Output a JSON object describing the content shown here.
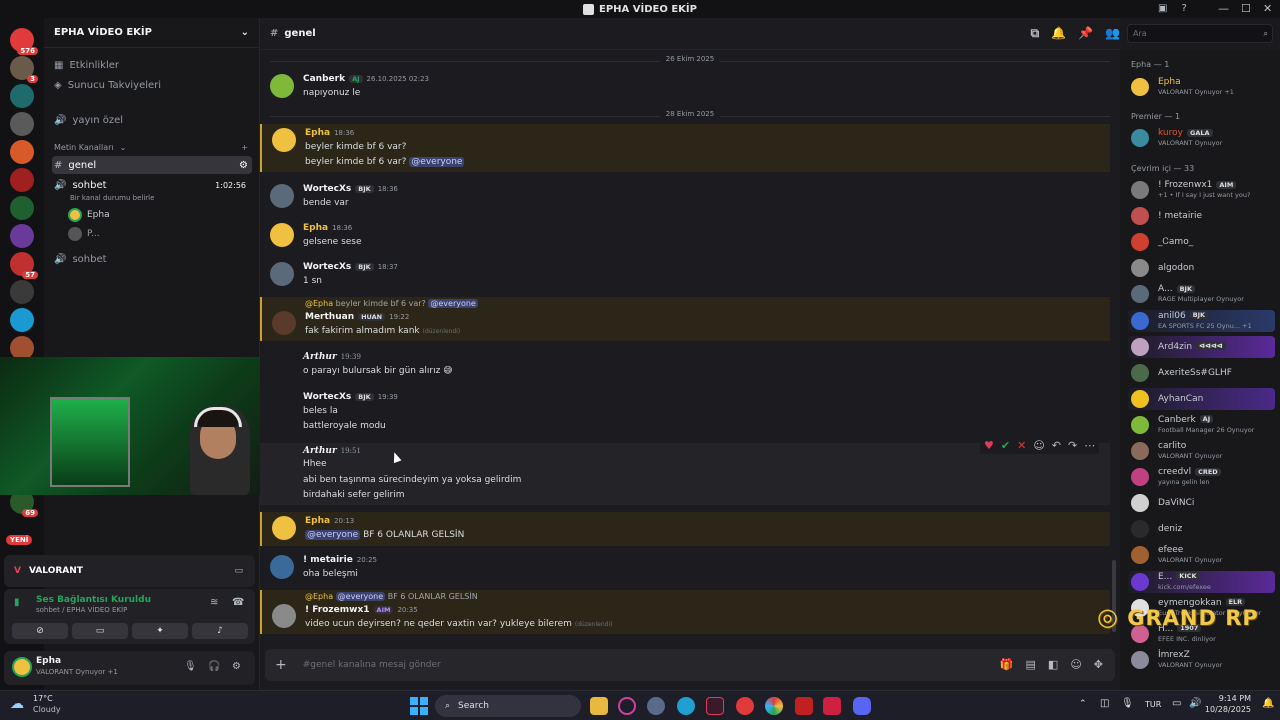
{
  "window": {
    "title": "EPHA VİDEO EKİP"
  },
  "guilds": {
    "badges": [
      "576",
      "3",
      "57",
      "69"
    ],
    "new_label": "YENİ"
  },
  "server": {
    "name": "EPHA VİDEO EKİP",
    "top_items": [
      "Etkinlikler",
      "Sunucu Takviyeleri"
    ],
    "channels": {
      "yayin": "yayın özel",
      "category": "Metin Kanalları",
      "genel": "genel",
      "sohbet_voice": "sohbet",
      "sohbet_time": "1:02:56",
      "sohbet_status": "Bir kanal durumu belirle",
      "voice_users": [
        "Epha",
        "P..."
      ],
      "sohbet2": "sohbet"
    }
  },
  "voice_panel": {
    "game": "VALORANT",
    "connection": "Ses Bağlantısı Kuruldu",
    "location": "sohbet / EPHA VİDEO EKİP"
  },
  "user": {
    "name": "Epha",
    "activity": "VALORANT Oynuyor +1"
  },
  "channel": {
    "name": "genel",
    "composer_placeholder": "#genel kanalına mesaj gönder",
    "dates": [
      "26 Ekim 2025",
      "28 Ekim 2025"
    ]
  },
  "messages": [
    {
      "author": "Canberk",
      "tag": "AJ",
      "time": "26.10.2025 02:23",
      "lines": [
        "napıyonuz le"
      ]
    },
    {
      "author": "Epha",
      "time": "18:36",
      "lines": [
        "beyler kimde bf 6 var?",
        "beyler kimde bf 6 var?"
      ],
      "mention": "@everyone"
    },
    {
      "author": "WortecXs",
      "tag": "BJK",
      "time": "18:36",
      "lines": [
        "bende var"
      ]
    },
    {
      "author": "Epha",
      "time": "18:36",
      "lines": [
        "gelsene sese"
      ]
    },
    {
      "author": "WortecXs",
      "tag": "BJK",
      "time": "18:37",
      "lines": [
        "1 sn"
      ]
    },
    {
      "reply_to": "@Epha",
      "reply_text": "beyler kimde bf 6 var?",
      "reply_mention": "@everyone",
      "author": "Merthuan",
      "tag": "HUAN",
      "time": "19:22",
      "lines": [
        "fak fakirim almadım kank"
      ],
      "edited": "(düzenlendi)"
    },
    {
      "author": "Arthur",
      "time": "19:39",
      "lines": [
        "o parayı bulursak bir gün alırız 😅"
      ]
    },
    {
      "author": "WortecXs",
      "tag": "BJK",
      "time": "19:39",
      "lines": [
        "beles la",
        "battleroyale modu"
      ]
    },
    {
      "author": "Arthur",
      "time": "19:51",
      "lines": [
        "Hhee",
        "abi ben taşınma sürecindeyim ya yoksa gelirdim",
        "birdahaki sefer gelirim"
      ]
    },
    {
      "author": "Epha",
      "time": "20:13",
      "mention": "@everyone",
      "lines": [
        "BF 6 OLANLAR GELSİN"
      ]
    },
    {
      "author": "! metairie",
      "time": "20:25",
      "lines": [
        "oha beleşmi"
      ]
    },
    {
      "reply_to": "@Epha",
      "reply_mention": "@everyone",
      "reply_text": "BF 6 OLANLAR GELSİN",
      "author": "! Frozemwx1",
      "tag": "AIM",
      "time": "20:35",
      "lines": [
        "video ucun deyirsen? ne qeder vaxtin var? yukleye bilerem"
      ],
      "edited": "(düzenlendi)"
    }
  ],
  "search": {
    "placeholder": "Ara"
  },
  "members": {
    "groups": [
      "Epha — 1",
      "Premier — 1",
      "Çevrim içi — 33"
    ],
    "list": [
      {
        "name": "Epha",
        "activity": "VALORANT Oynuyor +1",
        "color": "#f0c040"
      },
      {
        "name": "kuroy",
        "tag": "GALA",
        "activity": "VALORANT Oynuyor",
        "color": "#e0552e"
      },
      {
        "name": "! Frozenwx1",
        "tag": "AIM",
        "activity": "+1 • If I say I just want you?"
      },
      {
        "name": "! metairie"
      },
      {
        "name": "_Ꮯamo_"
      },
      {
        "name": "algodon"
      },
      {
        "name": "A...",
        "tag": "BJK",
        "activity": "RAGE Multiplayer Oynuyor"
      },
      {
        "name": "anil06",
        "tag": "BJK",
        "activity": "EA SPORTS FC 25 Oynu... +1"
      },
      {
        "name": "Ard4zin",
        "tag": "ᐊᐊᐊᐊ"
      },
      {
        "name": "AxeriteSs#GLHF"
      },
      {
        "name": "AyhanCan"
      },
      {
        "name": "Canberk",
        "tag": "AJ",
        "activity": "Football Manager 26 Oynuyor"
      },
      {
        "name": "carlito",
        "activity": "VALORANT Oynuyor"
      },
      {
        "name": "creedvl",
        "tag": "CRED",
        "activity": "yayına gelin len"
      },
      {
        "name": "DaViNCi"
      },
      {
        "name": "deniz"
      },
      {
        "name": "efeee",
        "activity": "VALORANT Oynuyor"
      },
      {
        "name": "E...",
        "tag": "KICK",
        "activity": "kick.com/efexee"
      },
      {
        "name": "eymengokkan",
        "tag": "ELR",
        "activity": "Euro Truck Simulator 2 Oynuyor"
      },
      {
        "name": "H...",
        "tag": "1907",
        "activity": "EFEE INC. dinliyor"
      },
      {
        "name": "İmrexZ",
        "activity": "VALORANT Oynuyor"
      }
    ]
  },
  "watermark": "GRAND RP",
  "taskbar": {
    "weather_temp": "17°C",
    "weather_desc": "Cloudy",
    "search": "Search",
    "lang": "TUR",
    "time": "9:14 PM",
    "date": "10/28/2025"
  }
}
